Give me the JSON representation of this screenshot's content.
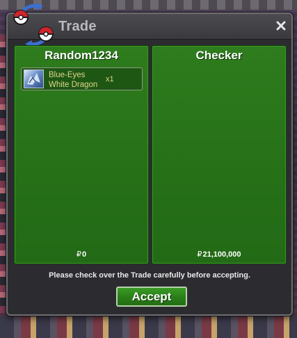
{
  "window": {
    "title": "Trade",
    "close_icon": "close-icon"
  },
  "colors": {
    "panel_green": "#267018",
    "item_text": "#e1d58c",
    "title_text": "#b9b9be",
    "window_bg": "#2c2c30"
  },
  "left_panel": {
    "player_name": "Random1234",
    "items": [
      {
        "name_line1": "Blue-Eyes",
        "name_line2": "White Dragon",
        "quantity": "x1",
        "icon": "card-icon"
      }
    ],
    "money_symbol": "₽",
    "money": "0"
  },
  "right_panel": {
    "player_name": "Checker",
    "items": [],
    "money_symbol": "₽",
    "money": "21,100,000"
  },
  "notice": "Please check over the Trade carefully before accepting.",
  "accept_label": "Accept"
}
